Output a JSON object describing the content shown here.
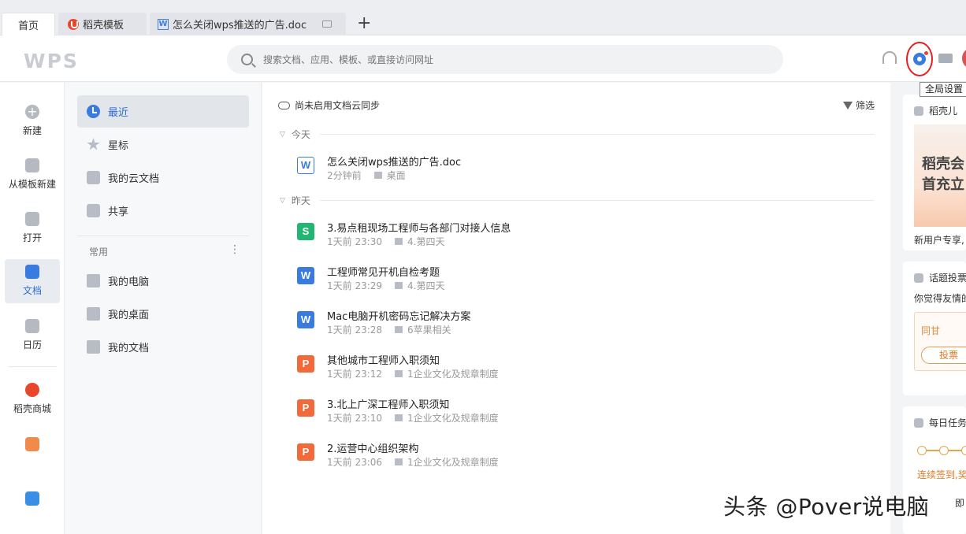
{
  "tabs": [
    {
      "label": "首页"
    },
    {
      "label": "稻壳模板"
    },
    {
      "label": "怎么关闭wps推送的广告.doc"
    }
  ],
  "header": {
    "logo": "WPS",
    "search_placeholder": "搜索文档、应用、模板、或直接访问网址",
    "tooltip": "全局设置"
  },
  "rail": {
    "new": "新建",
    "from_template": "从模板新建",
    "open": "打开",
    "docs": "文档",
    "calendar": "日历",
    "mall": "稻壳商城"
  },
  "nav": {
    "recent": "最近",
    "starred": "星标",
    "cloud_docs": "我的云文档",
    "shared": "共享",
    "section_common": "常用",
    "my_computer": "我的电脑",
    "my_desktop": "我的桌面",
    "my_documents": "我的文档"
  },
  "main": {
    "sync_status": "尚未启用文档云同步",
    "filter": "筛选",
    "group_today": "今天",
    "group_yesterday": "昨天",
    "files": [
      {
        "name": "怎么关闭wps推送的广告.doc",
        "time": "2分钟前",
        "location": "桌面",
        "type": "w-out",
        "glyph": "W"
      },
      {
        "name": "3.易点租现场工程师与各部门对接人信息",
        "time": "1天前 23:30",
        "location": "4.第四天",
        "type": "s",
        "glyph": "S"
      },
      {
        "name": "工程师常见开机自检考题",
        "time": "1天前 23:29",
        "location": "4.第四天",
        "type": "w",
        "glyph": "W"
      },
      {
        "name": "Mac电脑开机密码忘记解决方案",
        "time": "1天前 23:28",
        "location": "6苹果相关",
        "type": "w",
        "glyph": "W"
      },
      {
        "name": "其他城市工程师入职须知",
        "time": "1天前 23:12",
        "location": "1企业文化及规章制度",
        "type": "p",
        "glyph": "P"
      },
      {
        "name": "3.北上广深工程师入职须知",
        "time": "1天前 23:10",
        "location": "1企业文化及规章制度",
        "type": "p",
        "glyph": "P"
      },
      {
        "name": "2.运营中心组织架构",
        "time": "1天前 23:06",
        "location": "1企业文化及规章制度",
        "type": "p",
        "glyph": "P"
      }
    ]
  },
  "right_panel": {
    "card1_title": "稻壳儿",
    "card1_promo_line1": "稻壳会",
    "card1_promo_line2": "首充立",
    "card1_footer": "新用户专享,",
    "card2_title": "话题投票",
    "card2_question": "你觉得友情的",
    "card2_option": "同甘",
    "card2_vote_button": "投票",
    "card3_title": "每日任务",
    "card3_note": "连续签到,奖",
    "card3_note2": "即"
  },
  "watermark": "头条 @Pover说电脑"
}
